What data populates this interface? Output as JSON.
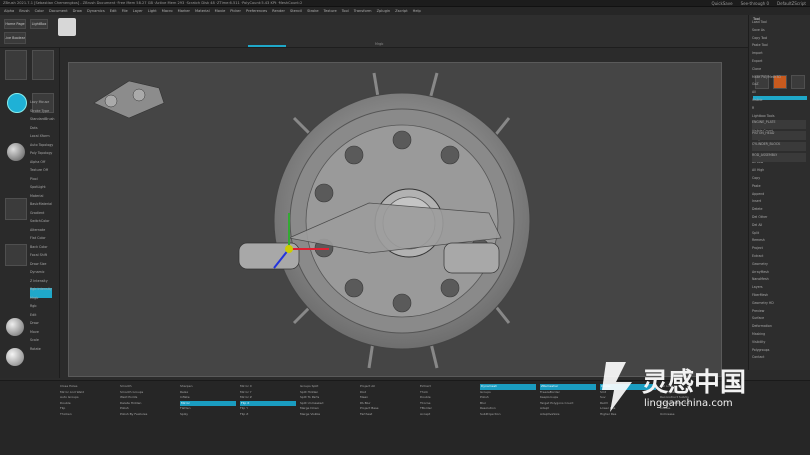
{
  "window": {
    "title": "ZBrush 2021.7.1 [Sebastian Chemengkos] - ZBrush Document   ·Free Mem 58.27 GB ·Active Mem 293 ·Scratch Disk 48 ·ZTime:6.511 ·PolyCount:5.43 KPt ·MeshCount:2",
    "right_items": [
      "QuickSave",
      "See-through 0",
      "DefaultZScript"
    ]
  },
  "menu": [
    "Alpha",
    "Brush",
    "Color",
    "Document",
    "Draw",
    "Dynamics",
    "Edit",
    "File",
    "Layer",
    "Light",
    "Macro",
    "Marker",
    "Material",
    "Movie",
    "Picker",
    "Preferences",
    "Render",
    "Stencil",
    "Stroke",
    "Texture",
    "Tool",
    "Transform",
    "Zplugin",
    "Zscript",
    "Help"
  ],
  "toolbar": {
    "home": "Home Page",
    "lightbox": "LightBox",
    "live_boolean": "Live Boolean",
    "tab_active": "Mrgb"
  },
  "left_panel": {
    "items": [
      "Lazy Mouse",
      "Stroke Type",
      "StandardBrush",
      "Dots",
      "Local Xform",
      "Auto Topology",
      "Poly Topology",
      "Alpha Off",
      "Texture Off",
      "Pixol",
      "SpotLight",
      "Material",
      "BasicMaterial",
      "Gradient",
      "SwitchColor",
      "Alternate",
      "Flat Color",
      "Back Color",
      "Focal Shift",
      "Draw Size",
      "Dynamic",
      "Z Intensity",
      "Rgb Intensity",
      "Mrgb",
      "Rgb",
      "Edit",
      "Draw",
      "Move",
      "Scale",
      "Rotate"
    ],
    "palette_labels": [
      "Zadd",
      "Zsub",
      "Zcut"
    ]
  },
  "viewport": {
    "tooltip": "Flips current subtool on X axis. Works on models with subdiv levels."
  },
  "right_panel": {
    "header": "Tool",
    "rows": [
      "Load Tool",
      "Save As",
      "Copy Tool",
      "Paste Tool",
      "Import",
      "Export",
      "Clone",
      "Make PolyMesh3D",
      "GoZ",
      "All",
      "Visible",
      "R",
      "Lightbox Tools",
      "SubTool",
      "Visible Count",
      "Merge",
      "Rename",
      "AutoReorder",
      "All Low",
      "All High",
      "Copy",
      "Paste",
      "Append",
      "Insert",
      "Delete",
      "Del Other",
      "Del All",
      "Split",
      "Remesh",
      "Project",
      "Extract",
      "Geometry",
      "ArrayMesh",
      "NanoMesh",
      "Layers",
      "FiberMesh",
      "Geometry HD",
      "Preview",
      "Surface",
      "Deformation",
      "Masking",
      "Visibility",
      "Polygroups",
      "Contact"
    ],
    "subtool_names": [
      "ENGINE_PLATE",
      "PISTON_HEAD",
      "CYLINDER_BLOCK",
      "ROD_ASSEMBLY"
    ]
  },
  "bottom": {
    "columns": [
      [
        "Close Holes",
        "Mirror And Weld",
        "Auto Groups",
        "Double",
        "Flip",
        "Thicken"
      ],
      [
        "Smooth",
        "Smooth Groups",
        "Weld Points",
        "Delete Hidden",
        "Polish",
        "Polish By Features"
      ],
      [
        "Sharpen",
        "Relax",
        "Inflate",
        "Mirror",
        "Flatten",
        "Spiky"
      ],
      [
        "Mirror X",
        "Mirror Y",
        "Mirror Z",
        "Flip X",
        "Flip Y",
        "Flip Z"
      ],
      [
        "Groups Split",
        "Split Hidden",
        "Split To Parts",
        "Split Unmasked",
        "Merge Down",
        "Merge Visible"
      ],
      [
        "Project All",
        "Dist",
        "Mean",
        "PA Blur",
        "Project Base",
        "Farthest"
      ],
      [
        "Extract",
        "Thick",
        "Double",
        "TCorne",
        "TBorder",
        "Accept"
      ],
      [
        "Dynamesh",
        "Groups",
        "Polish",
        "Blur",
        "Resolution",
        "SubProjection"
      ],
      [
        "ZRemesher",
        "FreezeBorder",
        "KeepGroups",
        "Target Polygons Count",
        "Adapt",
        "AdaptiveSize"
      ],
      [
        "Divide",
        "Smt",
        "Suv",
        "ReUV",
        "Lower Res",
        "Higher Res"
      ],
      [
        "Del Lower",
        "Del Higher",
        "Reconstruct Subdiv",
        "Convert BPR To Geo",
        "Crease",
        "UnCrease"
      ]
    ],
    "highlight_labels": [
      "Flip X",
      "Mirror",
      "Dynamesh",
      "Divide",
      "ZRemesher"
    ]
  },
  "watermark": {
    "brand": "灵感中国",
    "url": "lingganchina.com"
  },
  "colors": {
    "accent": "#1fa8c9",
    "background": "#2b2b2b",
    "viewport": "#454545"
  }
}
